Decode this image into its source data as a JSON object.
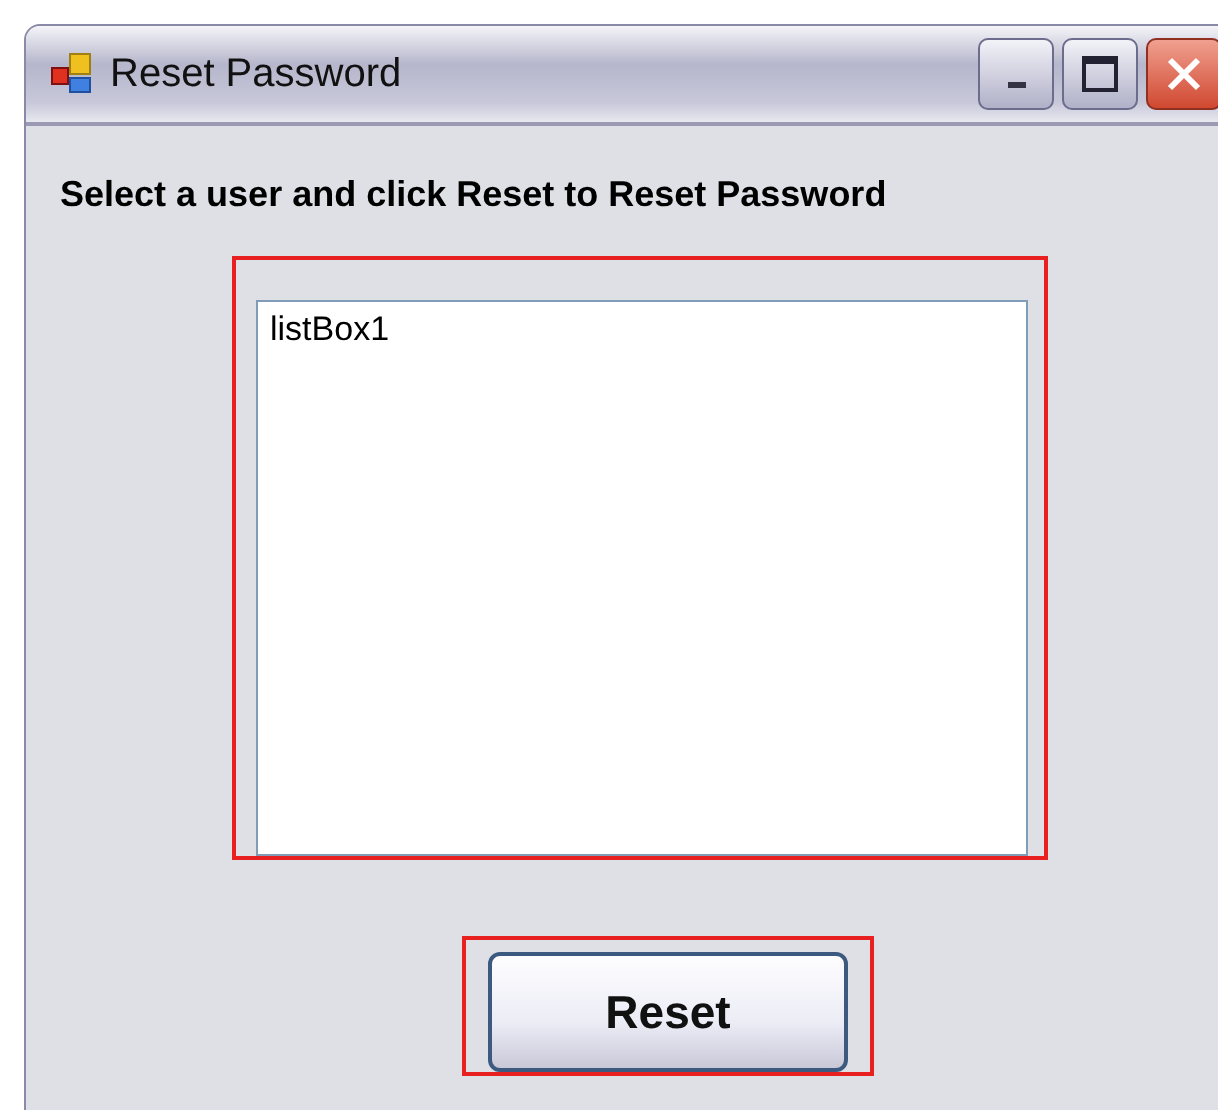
{
  "window": {
    "title": "Reset Password"
  },
  "instruction": "Select a user and click Reset to Reset Password",
  "list_box": {
    "items": [
      "listBox1"
    ]
  },
  "buttons": [
    "Reset"
  ]
}
